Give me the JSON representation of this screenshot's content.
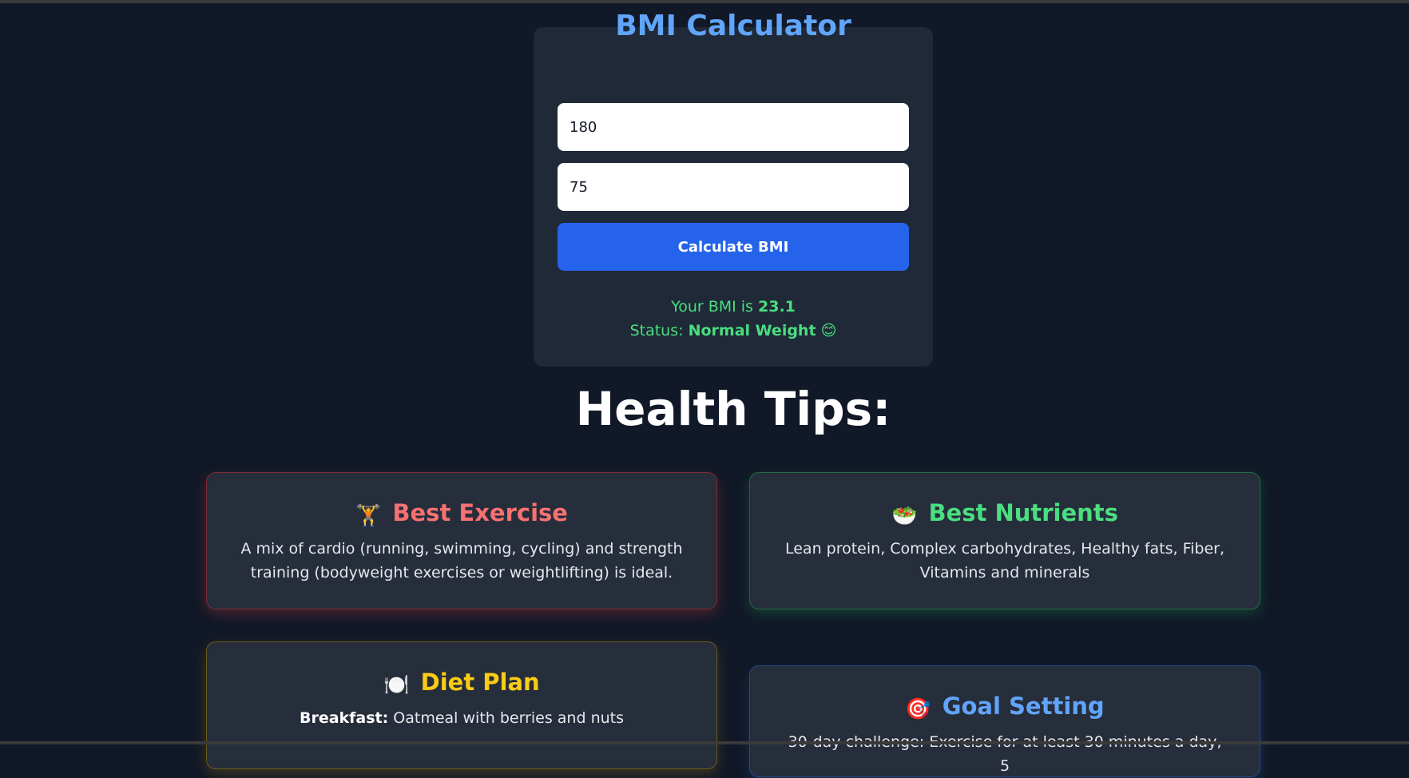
{
  "calculator": {
    "title": "BMI Calculator",
    "height_value": "180",
    "weight_value": "75",
    "button_label": "Calculate BMI",
    "result_prefix": "Your BMI is ",
    "bmi_value": "23.1",
    "status_prefix": "Status: ",
    "status_value": "Normal Weight",
    "status_emoji": "😊"
  },
  "tips": {
    "heading": "Health Tips:",
    "exercise": {
      "icon": "weightlifter-icon",
      "icon_glyph": "🏋️",
      "title": "Best Exercise",
      "text": "A mix of cardio (running, swimming, cycling) and strength training (bodyweight exercises or weightlifting) is ideal."
    },
    "nutrients": {
      "icon": "salad-icon",
      "icon_glyph": "🥗",
      "title": "Best Nutrients",
      "text": "Lean protein, Complex carbohydrates, Healthy fats, Fiber, Vitamins and minerals"
    },
    "diet": {
      "icon": "plate-icon",
      "icon_glyph": "🍽️",
      "title": "Diet Plan",
      "label": "Breakfast:",
      "text": " Oatmeal with berries and nuts"
    },
    "goal": {
      "icon": "target-icon",
      "icon_glyph": "🎯",
      "title": "Goal Setting",
      "text": "30-day challenge: Exercise for at least 30 minutes a day, 5"
    }
  },
  "colors": {
    "background": "#111827",
    "card": "#1f2937",
    "accent_blue": "#60a5fa",
    "button": "#2563eb",
    "green": "#4ade80",
    "red": "#f87171",
    "yellow": "#facc15"
  }
}
